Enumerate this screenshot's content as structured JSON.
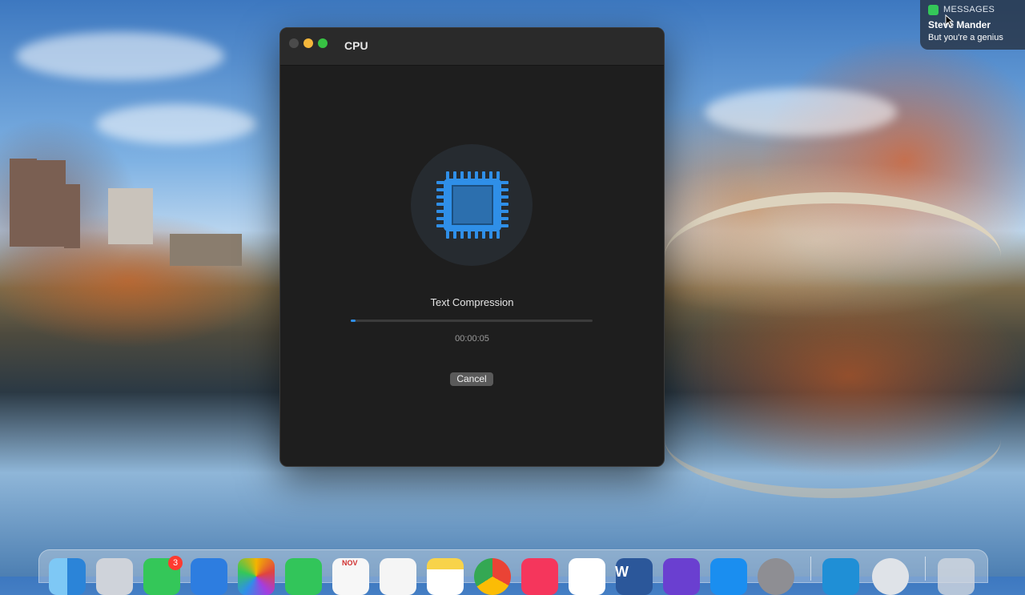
{
  "window": {
    "title": "CPU",
    "task_name": "Text Compression",
    "progress_percent": 1,
    "elapsed": "00:00:05",
    "cancel_label": "Cancel",
    "accent_color": "#2f8fe8"
  },
  "notification": {
    "app": "MESSAGES",
    "sender": "Steve Mander",
    "message": "But you're a genius"
  },
  "dock": {
    "messages_badge": "3",
    "calendar_month": "NOV",
    "word_letter": "W",
    "icons": [
      "finder-icon",
      "launchpad-icon",
      "messages-icon",
      "mail-icon",
      "photos-icon",
      "facetime-icon",
      "calendar-icon",
      "home-icon",
      "notes-icon",
      "chrome-icon",
      "music-icon",
      "news-icon",
      "word-icon",
      "imovie-icon",
      "app-store-icon",
      "system-preferences-icon",
      "stocks-icon",
      "quicktime-icon",
      "trash-icon"
    ]
  }
}
